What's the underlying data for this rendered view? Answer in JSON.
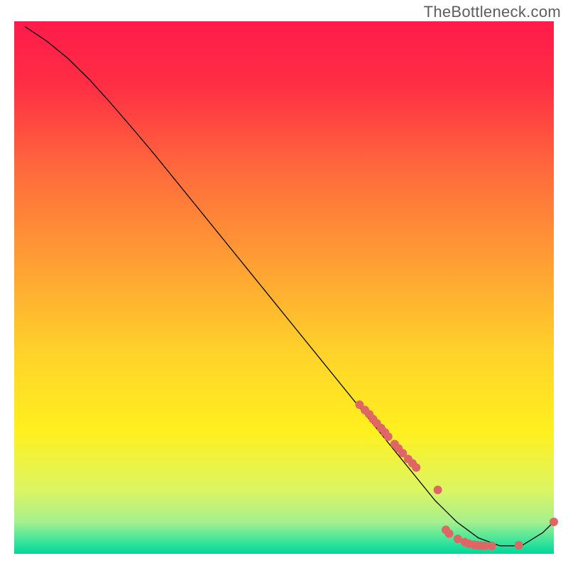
{
  "watermark": "TheBottleneck.com",
  "chart_data": {
    "type": "line",
    "title": "",
    "xlabel": "",
    "ylabel": "",
    "xlim": [
      0,
      100
    ],
    "ylim": [
      0,
      100
    ],
    "background_gradient_stops": [
      {
        "offset": 0.0,
        "color": "#ff1b4b"
      },
      {
        "offset": 0.12,
        "color": "#ff2e44"
      },
      {
        "offset": 0.28,
        "color": "#ff6a3c"
      },
      {
        "offset": 0.45,
        "color": "#ff9e34"
      },
      {
        "offset": 0.62,
        "color": "#ffd22a"
      },
      {
        "offset": 0.77,
        "color": "#fff01f"
      },
      {
        "offset": 0.88,
        "color": "#dcf562"
      },
      {
        "offset": 0.94,
        "color": "#a6f08e"
      },
      {
        "offset": 0.975,
        "color": "#3fe59a"
      },
      {
        "offset": 1.0,
        "color": "#00d69a"
      }
    ],
    "series": [
      {
        "name": "bottleneck-curve",
        "color": "#000000",
        "width": 1.3,
        "x": [
          2,
          6,
          10,
          14,
          18,
          22,
          26,
          30,
          34,
          38,
          42,
          46,
          50,
          54,
          58,
          62,
          66,
          70,
          74,
          78,
          82,
          86,
          90,
          94,
          98,
          100
        ],
        "y": [
          99,
          96.3,
          93,
          89,
          84.5,
          79.8,
          75,
          70,
          65,
          60,
          55,
          50,
          45,
          40,
          35,
          30,
          25,
          20,
          15,
          10,
          6,
          3,
          1.5,
          1.5,
          4,
          6
        ]
      }
    ],
    "scatter": [
      {
        "name": "data-points",
        "color": "#e06666",
        "radius": 6,
        "x": [
          64,
          65,
          65.8,
          66.5,
          67.2,
          68,
          68.7,
          69.3,
          70.5,
          71.2,
          72,
          73,
          73.8,
          74.5,
          78.5,
          80,
          80.6,
          82.2,
          83.5,
          84.2,
          85.2,
          85.8,
          86.5,
          87.2,
          88.5,
          93.5,
          100
        ],
        "y": [
          28,
          27,
          26.2,
          25.3,
          24.5,
          23.6,
          22.8,
          22,
          20.6,
          19.8,
          18.9,
          17.8,
          17,
          16.2,
          12,
          4.5,
          3.8,
          2.8,
          2.2,
          1.9,
          1.7,
          1.6,
          1.55,
          1.5,
          1.5,
          1.6,
          6
        ]
      }
    ]
  }
}
